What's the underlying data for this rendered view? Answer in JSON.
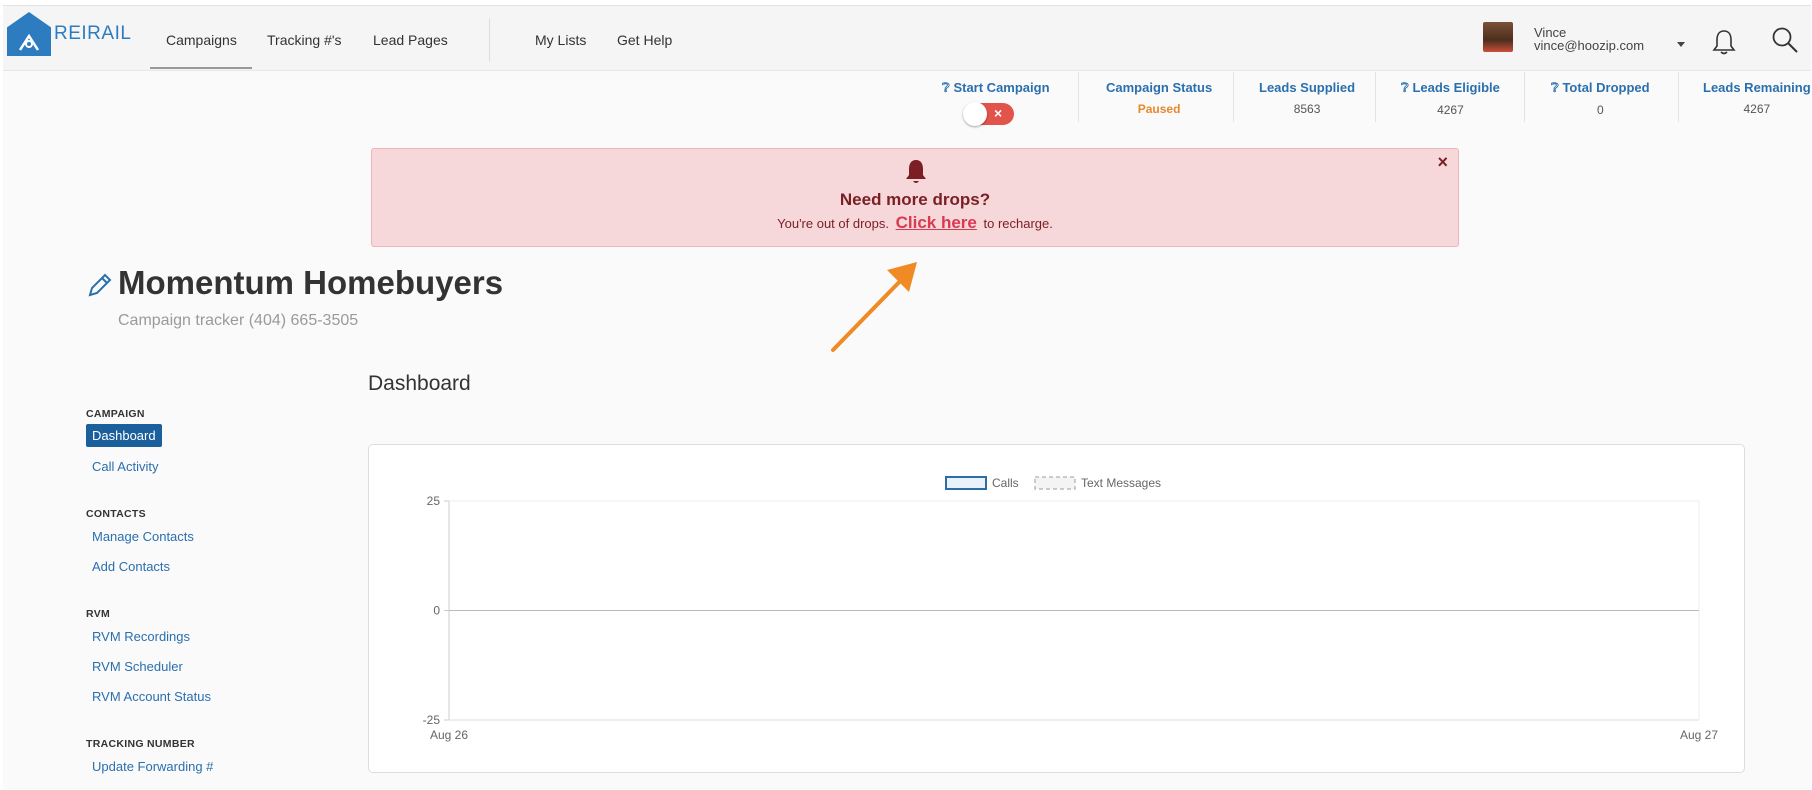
{
  "brand": {
    "name": "REIRAIL"
  },
  "nav": {
    "items": [
      "Campaigns",
      "Tracking #'s",
      "Lead Pages",
      "My Lists",
      "Get Help"
    ],
    "active": "Campaigns"
  },
  "user": {
    "name": "Vince",
    "email": "vince@hoozip.com"
  },
  "stats": {
    "start_campaign": "Start Campaign",
    "campaign_status_label": "Campaign Status",
    "campaign_status_value": "Paused",
    "leads_supplied_label": "Leads Supplied",
    "leads_supplied_value": "8563",
    "leads_eligible_label": "Leads Eligible",
    "leads_eligible_value": "4267",
    "total_dropped_label": "Total Dropped",
    "total_dropped_value": "0",
    "leads_remaining_label": "Leads Remaining",
    "leads_remaining_value": "4267",
    "toggle_on": false,
    "status_color": "#e8872b"
  },
  "alert": {
    "title": "Need more drops?",
    "text_before": "You're out of drops.",
    "link": "Click here",
    "text_after": "to recharge.",
    "close": "×"
  },
  "campaign": {
    "title": "Momentum Homebuyers",
    "subtitle": "Campaign tracker (404) 665-3505"
  },
  "sidebar": {
    "sections": [
      {
        "heading": "CAMPAIGN",
        "items": [
          "Dashboard",
          "Call Activity"
        ]
      },
      {
        "heading": "CONTACTS",
        "items": [
          "Manage Contacts",
          "Add Contacts"
        ]
      },
      {
        "heading": "RVM",
        "items": [
          "RVM Recordings",
          "RVM Scheduler",
          "RVM Account Status"
        ]
      },
      {
        "heading": "TRACKING NUMBER",
        "items": [
          "Update Forwarding #"
        ]
      }
    ],
    "active": "Dashboard"
  },
  "dashboard": {
    "title": "Dashboard"
  },
  "chart_data": {
    "type": "line",
    "title": "",
    "x": [
      "Aug 26",
      "Aug 27"
    ],
    "series": [
      {
        "name": "Calls",
        "values": [],
        "color": "#5a9fd4"
      },
      {
        "name": "Text Messages",
        "values": [],
        "color": "#bbbbbb"
      }
    ],
    "yticks": [
      25,
      0,
      -25
    ],
    "ylim": [
      -25,
      25
    ],
    "legend": "top-center",
    "grid": false
  },
  "colors": {
    "accent": "#2e7cc0",
    "link": "#2a6fae",
    "alert_bg": "#f6d7da",
    "danger": "#e2534b",
    "annotation_arrow": "#f08a24"
  }
}
